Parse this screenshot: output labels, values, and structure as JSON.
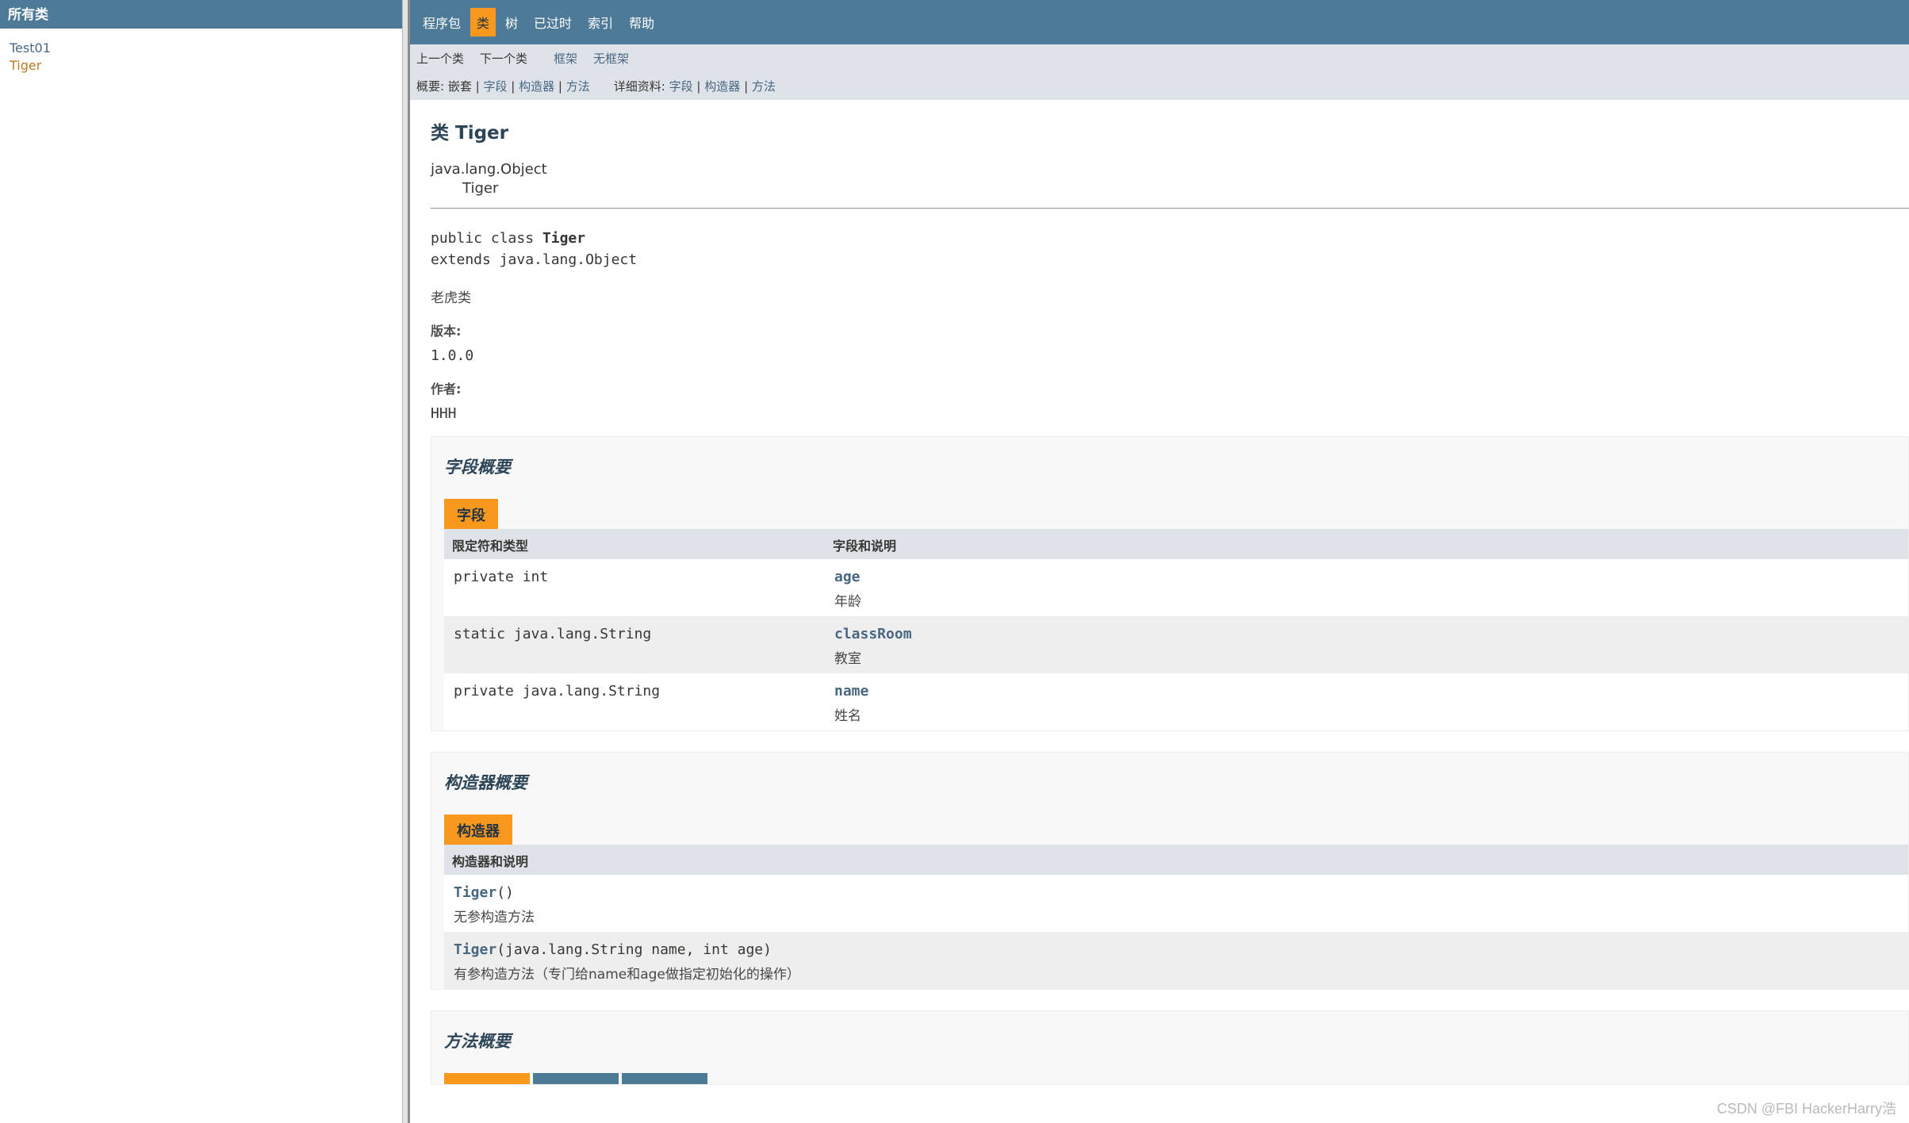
{
  "left": {
    "header": "所有类",
    "classes": [
      "Test01",
      "Tiger"
    ]
  },
  "topnav": {
    "items": [
      "程序包",
      "类",
      "树",
      "已过时",
      "索引",
      "帮助"
    ],
    "active": "类"
  },
  "subnav": {
    "prev_class": "上一个类",
    "next_class": "下一个类",
    "frames": "框架",
    "no_frames": "无框架",
    "summary_label": "概要:",
    "summary_nested": "嵌套",
    "summary_field": "字段",
    "summary_constructor": "构造器",
    "summary_method": "方法",
    "detail_label": "详细资料:",
    "detail_field": "字段",
    "detail_constructor": "构造器",
    "detail_method": "方法",
    "sep": "|"
  },
  "class_info": {
    "title": "类 Tiger",
    "inherit_parent": "java.lang.Object",
    "inherit_child": "Tiger",
    "decl_line1_prefix": "public class ",
    "decl_line1_name": "Tiger",
    "decl_line2": "extends java.lang.Object",
    "description": "老虎类",
    "version_label": "版本:",
    "version_value": "1.0.0",
    "author_label": "作者:",
    "author_value": "HHH"
  },
  "field_summary": {
    "heading": "字段概要",
    "caption": "字段",
    "col1": "限定符和类型",
    "col2": "字段和说明",
    "rows": [
      {
        "type": "private int",
        "name": "age",
        "desc": "年龄"
      },
      {
        "type": "static java.lang.String",
        "name": "classRoom",
        "desc": "教室"
      },
      {
        "type": "private java.lang.String",
        "name": "name",
        "desc": "姓名"
      }
    ]
  },
  "constructor_summary": {
    "heading": "构造器概要",
    "caption": "构造器",
    "col1": "构造器和说明",
    "rows": [
      {
        "name": "Tiger",
        "params": "()",
        "desc": "无参构造方法"
      },
      {
        "name": "Tiger",
        "params": "(java.lang.String name, int age)",
        "desc": "有参构造方法（专门给name和age做指定初始化的操作）"
      }
    ]
  },
  "method_summary": {
    "heading": "方法概要"
  },
  "watermark": "CSDN @FBI HackerHarry浩",
  "colors": {
    "nav": "#4d7a97",
    "subnav": "#dee3e9",
    "accent": "#f8981d",
    "link": "#4a6782",
    "selected_class": "#bb7a2a"
  }
}
